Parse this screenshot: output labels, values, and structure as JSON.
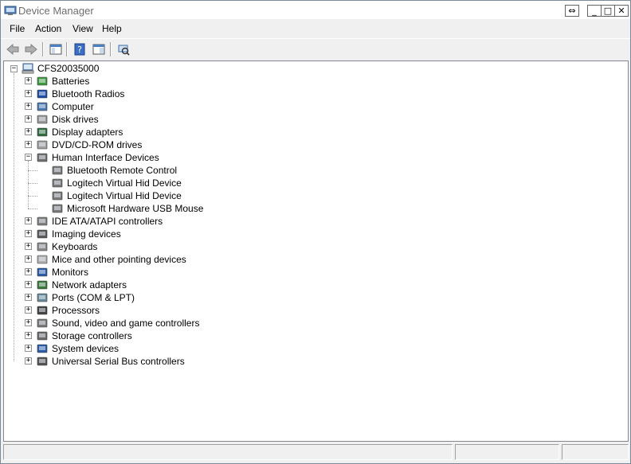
{
  "window": {
    "title": "Device Manager",
    "controls": {
      "restore_label": "⇔",
      "minimize_label": "_",
      "maximize_label": "□",
      "close_label": "✕"
    }
  },
  "menu": {
    "items": [
      "File",
      "Action",
      "View",
      "Help"
    ]
  },
  "toolbar": {
    "buttons": [
      "back-icon",
      "forward-icon",
      "show-hide-console-tree-icon",
      "help-icon",
      "properties-icon",
      "scan-hardware-icon"
    ]
  },
  "tree": {
    "root": "CFS20035000",
    "categories": [
      {
        "label": "Batteries",
        "icon": "battery-icon"
      },
      {
        "label": "Bluetooth Radios",
        "icon": "bluetooth-icon"
      },
      {
        "label": "Computer",
        "icon": "computer-icon"
      },
      {
        "label": "Disk drives",
        "icon": "disk-drive-icon"
      },
      {
        "label": "Display adapters",
        "icon": "display-adapter-icon"
      },
      {
        "label": "DVD/CD-ROM drives",
        "icon": "dvd-drive-icon"
      },
      {
        "label": "Human Interface Devices",
        "icon": "hid-icon",
        "expanded": true,
        "children": [
          "Bluetooth Remote Control",
          "Logitech Virtual Hid Device",
          "Logitech Virtual Hid Device",
          "Microsoft Hardware USB Mouse"
        ]
      },
      {
        "label": "IDE ATA/ATAPI controllers",
        "icon": "ide-controller-icon"
      },
      {
        "label": "Imaging devices",
        "icon": "imaging-icon"
      },
      {
        "label": "Keyboards",
        "icon": "keyboard-icon"
      },
      {
        "label": "Mice and other pointing devices",
        "icon": "mouse-icon"
      },
      {
        "label": "Monitors",
        "icon": "monitor-icon"
      },
      {
        "label": "Network adapters",
        "icon": "network-icon"
      },
      {
        "label": "Ports (COM & LPT)",
        "icon": "port-icon"
      },
      {
        "label": "Processors",
        "icon": "processor-icon"
      },
      {
        "label": "Sound, video and game controllers",
        "icon": "sound-icon"
      },
      {
        "label": "Storage controllers",
        "icon": "storage-icon"
      },
      {
        "label": "System devices",
        "icon": "system-icon"
      },
      {
        "label": "Universal Serial Bus controllers",
        "icon": "usb-icon"
      }
    ]
  },
  "status": {
    "cells": [
      "",
      "",
      ""
    ]
  }
}
